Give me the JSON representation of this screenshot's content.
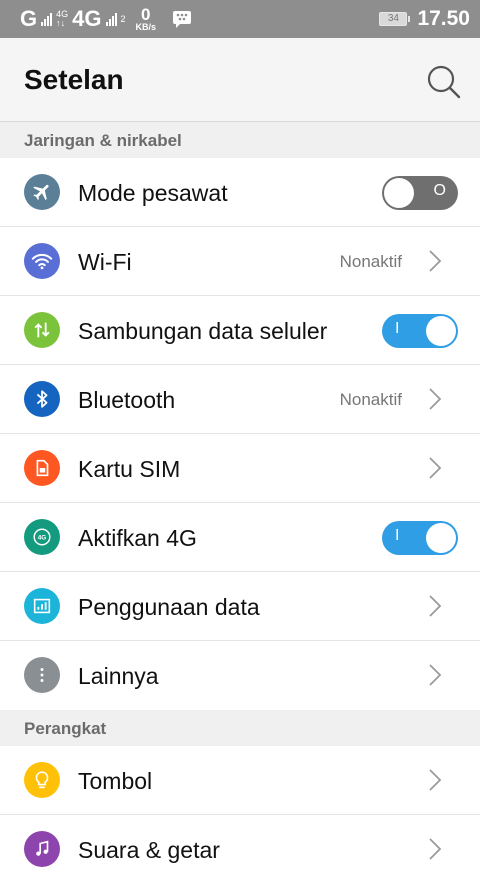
{
  "status_bar": {
    "carrier_letter": "G",
    "net_small_1": "4G",
    "net_small_2": "2",
    "net_4g": "4G",
    "speed_value": "0",
    "speed_unit": "KB/s",
    "battery": "34",
    "time": "17.50"
  },
  "header": {
    "title": "Setelan"
  },
  "sections": [
    {
      "title": "Jaringan & nirkabel",
      "items": [
        {
          "label": "Mode pesawat",
          "icon": "airplane-icon",
          "color": "#5b7f96",
          "control": "toggle",
          "state": "off",
          "mark": "O"
        },
        {
          "label": "Wi-Fi",
          "icon": "wifi-icon",
          "color": "#5a6fd6",
          "value": "Nonaktif",
          "control": "chevron"
        },
        {
          "label": "Sambungan data seluler",
          "icon": "data-arrows-icon",
          "color": "#7cc33c",
          "control": "toggle",
          "state": "on",
          "mark": "I"
        },
        {
          "label": "Bluetooth",
          "icon": "bluetooth-icon",
          "color": "#1565c0",
          "value": "Nonaktif",
          "control": "chevron"
        },
        {
          "label": "Kartu SIM",
          "icon": "sim-card-icon",
          "color": "#ff5722",
          "control": "chevron"
        },
        {
          "label": "Aktifkan 4G",
          "icon": "4g-icon",
          "color": "#149a7e",
          "control": "toggle",
          "state": "on",
          "mark": "I"
        },
        {
          "label": "Penggunaan data",
          "icon": "data-usage-icon",
          "color": "#1cb5d9",
          "control": "chevron"
        },
        {
          "label": "Lainnya",
          "icon": "more-dots-icon",
          "color": "#8a8f94",
          "control": "chevron"
        }
      ]
    },
    {
      "title": "Perangkat",
      "items": [
        {
          "label": "Tombol",
          "icon": "lightbulb-icon",
          "color": "#ffc107",
          "control": "chevron"
        },
        {
          "label": "Suara & getar",
          "icon": "music-note-icon",
          "color": "#8e44ad",
          "control": "chevron"
        }
      ]
    }
  ]
}
